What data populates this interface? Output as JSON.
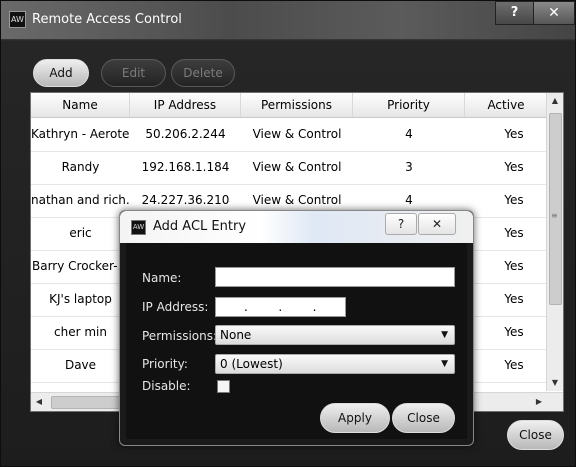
{
  "window": {
    "title": "Remote Access Control",
    "help_glyph": "?",
    "close_glyph": "✕",
    "icon_text": "AW"
  },
  "toolbar": {
    "add_label": "Add",
    "edit_label": "Edit",
    "delete_label": "Delete"
  },
  "table": {
    "columns": [
      "Name",
      "IP Address",
      "Permissions",
      "Priority",
      "Active"
    ],
    "rows": [
      [
        "Kathryn - Aerotec",
        "50.206.2.244",
        "View & Control",
        "4",
        "Yes"
      ],
      [
        "Randy",
        "192.168.1.184",
        "View & Control",
        "3",
        "Yes"
      ],
      [
        "nathan and rich...",
        "24.227.36.210",
        "View & Control",
        "4",
        "Yes"
      ],
      [
        "eric",
        "",
        "",
        "",
        "Yes"
      ],
      [
        "Barry Crocker-...",
        "",
        "",
        "",
        "Yes"
      ],
      [
        "KJ's laptop",
        "",
        "",
        "",
        "Yes"
      ],
      [
        "cher min",
        "",
        "",
        "",
        "Yes"
      ],
      [
        "Dave",
        "",
        "",
        "",
        "Yes"
      ]
    ]
  },
  "footer": {
    "close_label": "Close"
  },
  "dialog": {
    "title": "Add ACL Entry",
    "help_glyph": "?",
    "close_glyph": "✕",
    "icon_text": "AW",
    "name_label": "Name:",
    "name_value": "",
    "ip_label": "IP Address:",
    "ip_value": ".        .        .",
    "permissions_label": "Permissions:",
    "permissions_value": "None",
    "priority_label": "Priority:",
    "priority_value": "0 (Lowest)",
    "disable_label": "Disable:",
    "disable_checked": false,
    "apply_label": "Apply",
    "close_label": "Close"
  }
}
